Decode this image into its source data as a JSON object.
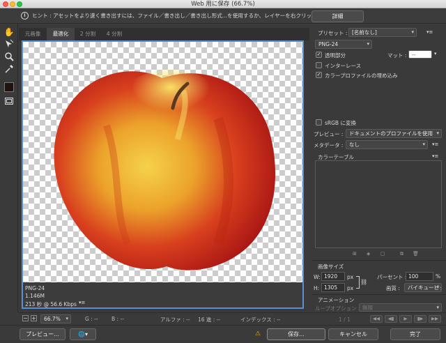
{
  "window": {
    "title": "Web 用に保存 (66.7%)"
  },
  "hint": {
    "text": "ヒント : アセットをより速く書き出すには、ファイル／書き出し／書き出し形式...を使用するか、レイヤーを右クリックして使用。"
  },
  "detail_button": "詳細",
  "tabs": [
    "元画像",
    "最適化",
    "2 分割",
    "4 分割"
  ],
  "active_tab": "最適化",
  "image_info": {
    "format": "PNG-24",
    "size": "1.146M",
    "time": "213 秒 @ 56.6 Kbps"
  },
  "statusbar": {
    "zoom": "66.7%",
    "g": "G : --",
    "b": "B : --",
    "alpha": "アルファ : --",
    "hex": "16 進 : --",
    "index": "インデックス : --"
  },
  "bottom": {
    "preview": "プレビュー...",
    "save": "保存...",
    "cancel": "キャンセル",
    "done": "完了"
  },
  "settings": {
    "preset_label": "プリセット :",
    "preset_value": "[名前なし]",
    "format_value": "PNG-24",
    "transparency": "透明部分",
    "transparency_checked": true,
    "matte_label": "マット :",
    "matte_value": "--",
    "interlace": "インターレース",
    "interlace_checked": false,
    "embed_profile": "カラープロファイルの埋め込み",
    "embed_checked": true,
    "srgb": "sRGB に変換",
    "srgb_checked": false,
    "preview_label": "プレビュー :",
    "preview_value": "ドキュメントのプロファイルを使用",
    "metadata_label": "メタデータ :",
    "metadata_value": "なし",
    "color_table_label": "カラーテーブル"
  },
  "image_size": {
    "title": "画像サイズ",
    "w_label": "W:",
    "w_value": "1920",
    "w_unit": "px",
    "h_label": "H:",
    "h_value": "1305",
    "h_unit": "px",
    "percent_label": "パーセント :",
    "percent_value": "100",
    "percent_unit": "%",
    "quality_label": "画質 :",
    "quality_value": "バイキュービック法"
  },
  "animation": {
    "title": "アニメーション",
    "loop_label": "ループオプション :",
    "loop_value": "無限",
    "frame_counter": "1 / 1"
  },
  "colors": {
    "accent": "#5b8fd1",
    "warning": "#f2b21d"
  }
}
